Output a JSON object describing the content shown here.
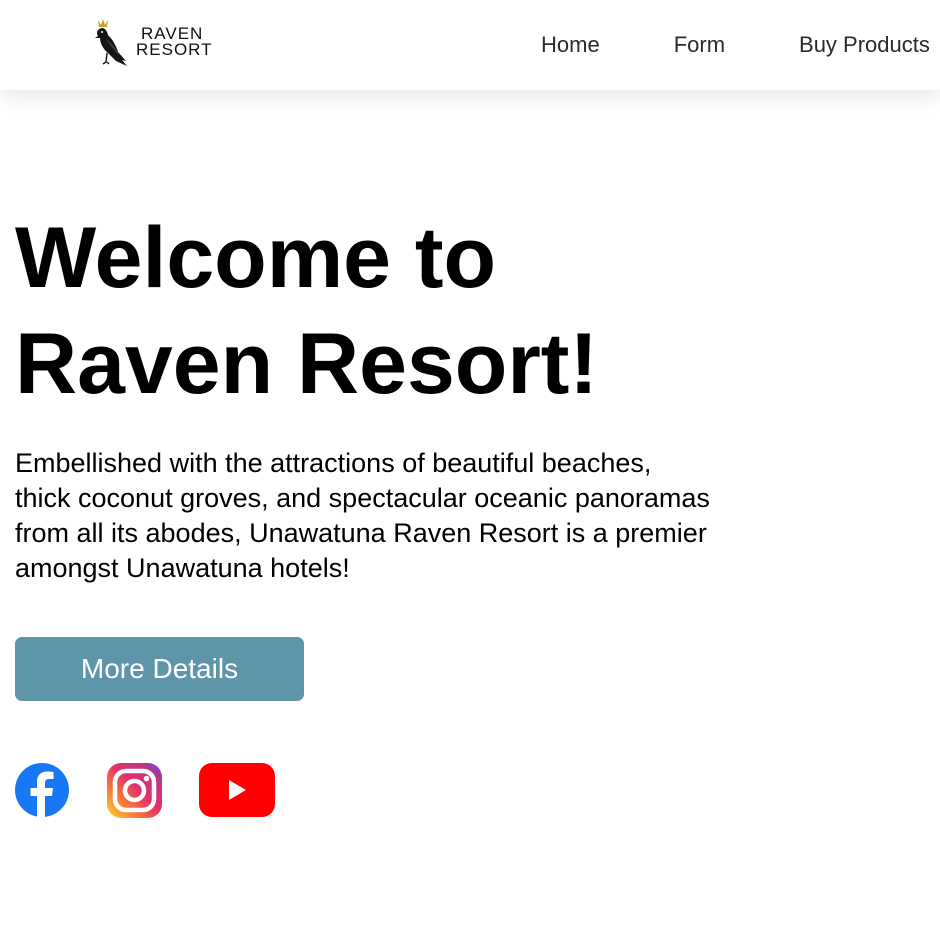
{
  "header": {
    "logo": {
      "line1": "RAVEN",
      "line2": "RESORT",
      "icon": "raven-crown-icon"
    },
    "nav": [
      {
        "label": "Home"
      },
      {
        "label": "Form"
      },
      {
        "label": "Buy Products"
      }
    ]
  },
  "hero": {
    "title_line1": "Welcome to",
    "title_line2": "Raven Resort!",
    "description_lines": [
      "Embellished with the attractions of beautiful beaches,",
      "thick coconut groves, and spectacular oceanic panoramas",
      "from all its abodes, Unawatuna Raven Resort is a premier",
      "amongst Unawatuna hotels!"
    ],
    "button_label": "More Details"
  },
  "social": [
    {
      "icon": "facebook-icon",
      "color": "#1877f2"
    },
    {
      "icon": "instagram-icon",
      "color": "#c13584"
    },
    {
      "icon": "youtube-icon",
      "color": "#ff0000"
    }
  ],
  "colors": {
    "accent_button": "#5f95a9",
    "nav_text": "#2b2b2b"
  }
}
